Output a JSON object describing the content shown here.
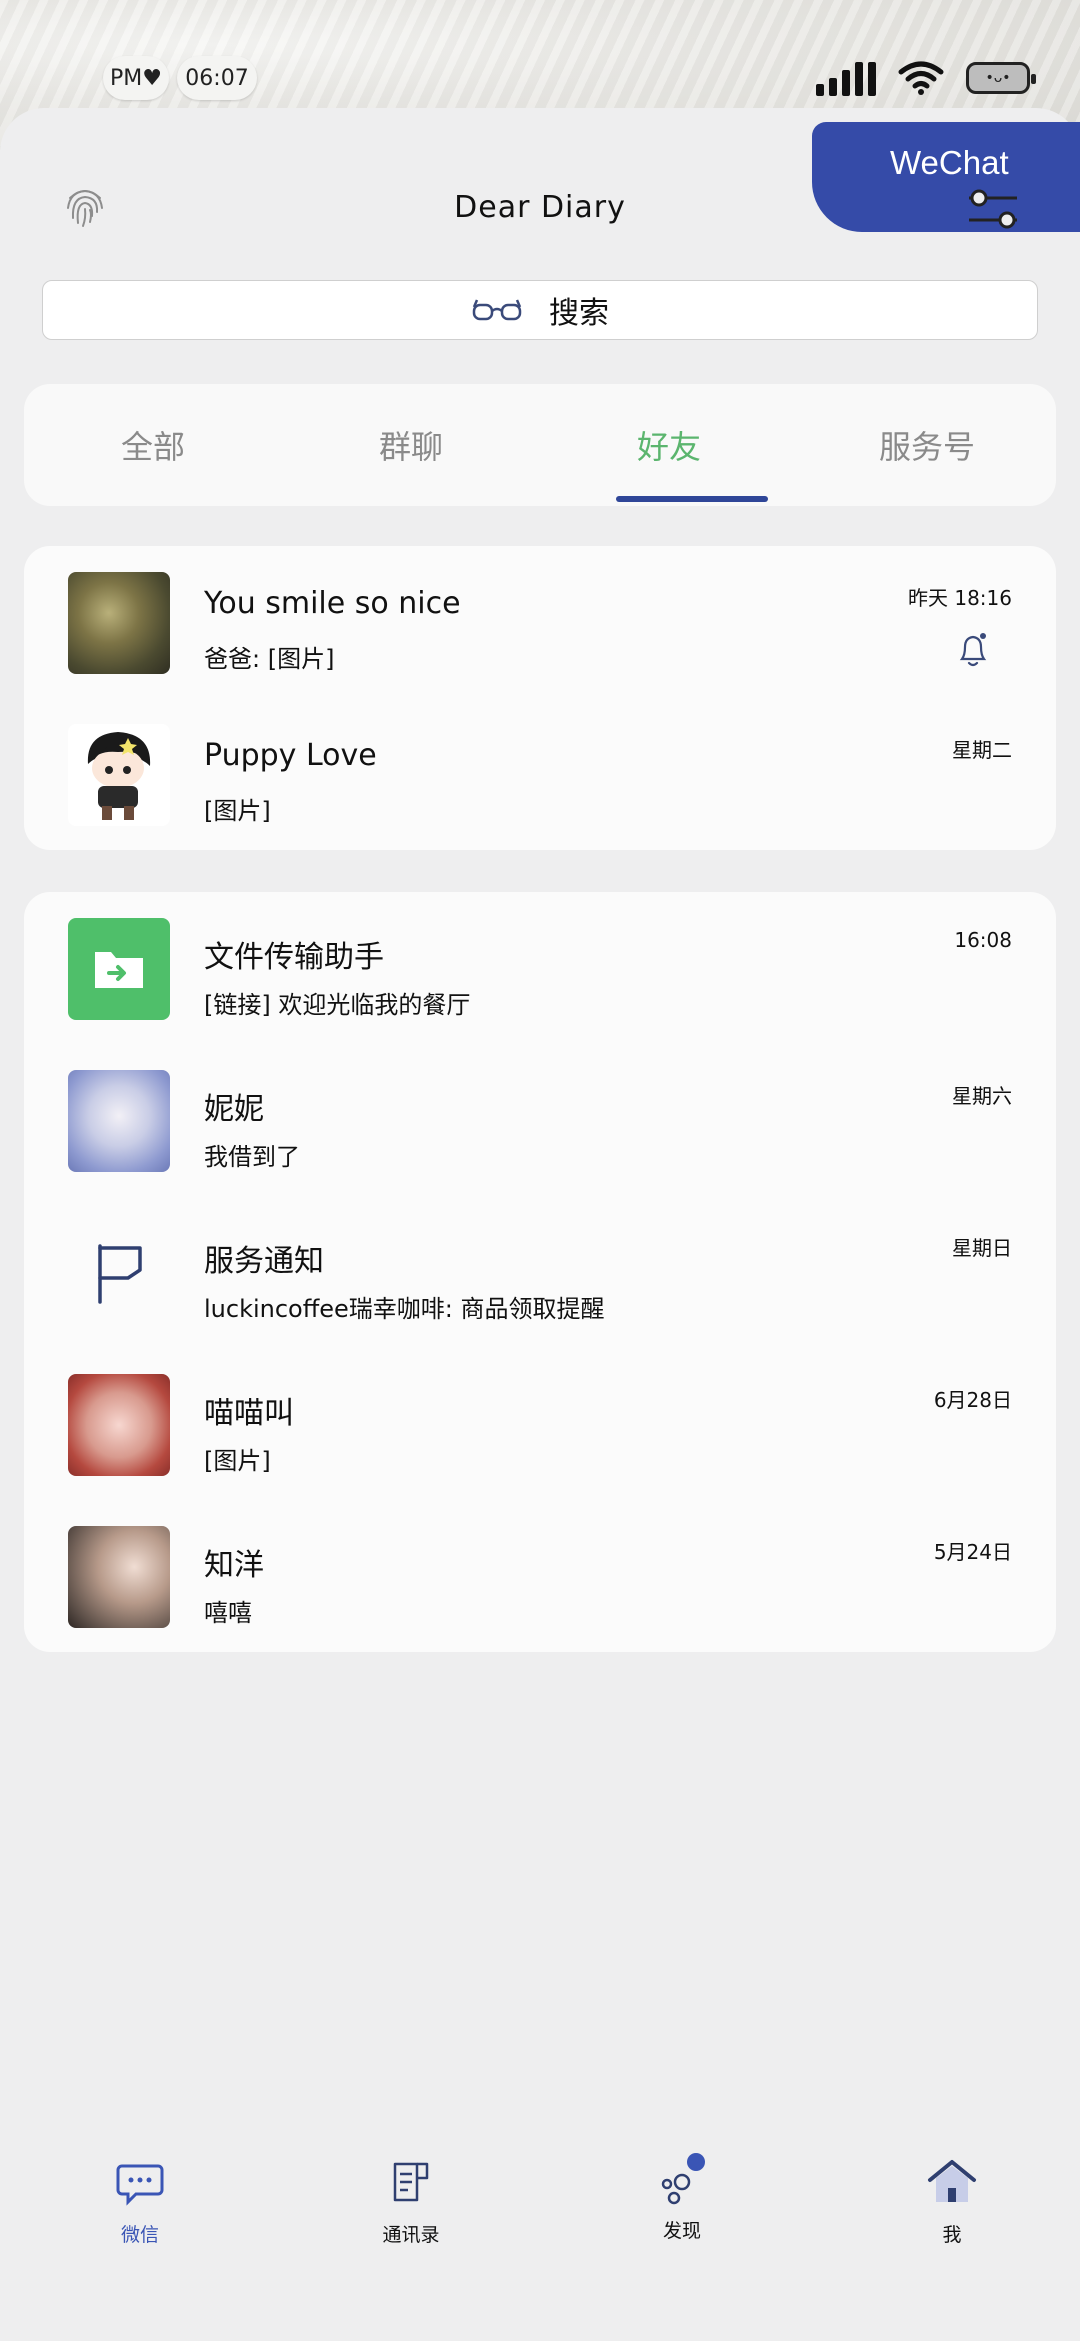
{
  "status_bar": {
    "pm": "PM♥",
    "time": "06:07",
    "battery_face": "•ᴗ•"
  },
  "header": {
    "title": "Dear Diary",
    "wechat_tab": "WeChat"
  },
  "search": {
    "placeholder": "搜索"
  },
  "tabs": [
    {
      "label": "全部",
      "active": false
    },
    {
      "label": "群聊",
      "active": false
    },
    {
      "label": "好友",
      "active": true
    },
    {
      "label": "服务号",
      "active": false
    }
  ],
  "pinned_chats": [
    {
      "name": "You smile so nice",
      "preview": "爸爸: [图片]",
      "time": "昨天 18:16",
      "muted": true
    },
    {
      "name": "Puppy Love",
      "preview": "[图片]",
      "time": "星期二",
      "muted": false
    }
  ],
  "chats": [
    {
      "name": "文件传输助手",
      "preview": "[链接] 欢迎光临我的餐厅",
      "time": "16:08"
    },
    {
      "name": "妮妮",
      "preview": "我借到了",
      "time": "星期六"
    },
    {
      "name": "服务通知",
      "preview": "luckincoffee瑞幸咖啡: 商品领取提醒",
      "time": "星期日"
    },
    {
      "name": "喵喵叫",
      "preview": "[图片]",
      "time": "6月28日"
    },
    {
      "name": "知洋",
      "preview": "嘻嘻",
      "time": "5月24日"
    }
  ],
  "bottom_nav": [
    {
      "label": "微信",
      "active": true
    },
    {
      "label": "通讯录",
      "active": false
    },
    {
      "label": "发现",
      "active": false
    },
    {
      "label": "我",
      "active": false
    }
  ],
  "colors": {
    "accent": "#354ba8",
    "tab_active": "#5bb56e",
    "file_green": "#4fbf6a"
  }
}
